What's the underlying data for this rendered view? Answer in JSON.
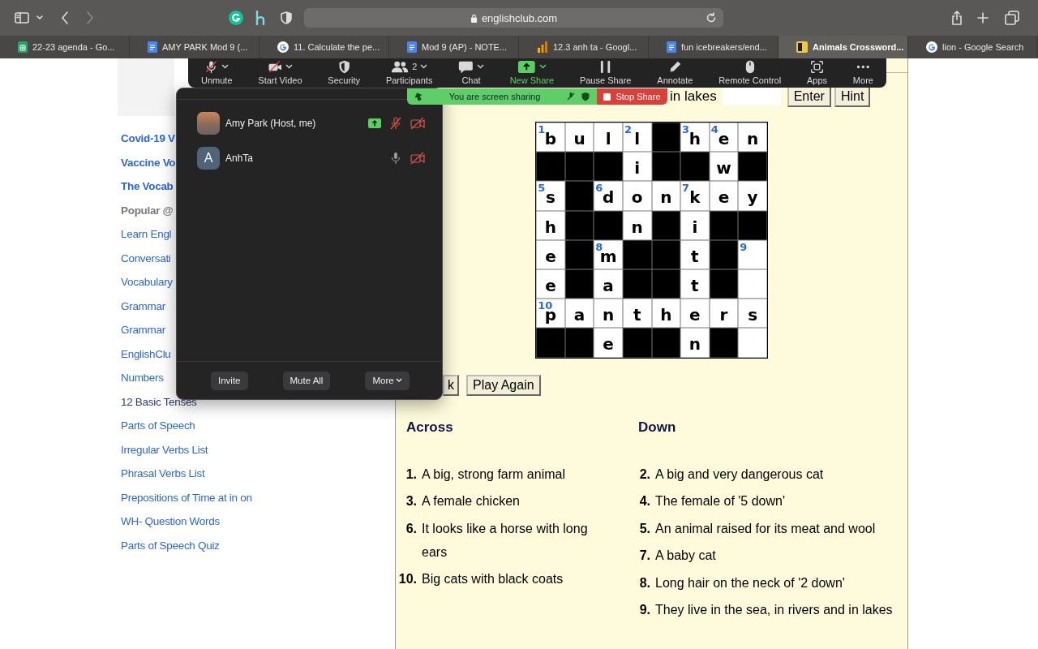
{
  "browser": {
    "address": "englishclub.com",
    "forward_disabled": true,
    "tabs": [
      {
        "title": "22-23 agenda - Go...",
        "kind": "sheets",
        "selected": false
      },
      {
        "title": "AMY PARK Mod 9 (...",
        "kind": "docs",
        "selected": false
      },
      {
        "title": "11. Calculate the pe...",
        "kind": "google",
        "selected": false
      },
      {
        "title": "Mod 9 (AP) - NOTE...",
        "kind": "docs",
        "selected": false
      },
      {
        "title": "12.3 anh ta - Googl...",
        "kind": "chart",
        "selected": false
      },
      {
        "title": "fun icebreakers/end...",
        "kind": "docs",
        "selected": false
      },
      {
        "title": "Animals Crossword...",
        "kind": "site",
        "selected": true
      },
      {
        "title": "lion - Google Search",
        "kind": "google",
        "selected": false
      }
    ]
  },
  "sidebar": {
    "links": [
      {
        "label": "Covid-19 V",
        "kind": "featured"
      },
      {
        "label": "Vaccine Vo",
        "kind": "featured"
      },
      {
        "label": "The Vocab",
        "kind": "featured"
      },
      {
        "label": "Popular @",
        "kind": "heading"
      },
      {
        "label": "Learn Engl",
        "kind": "link"
      },
      {
        "label": "Conversati",
        "kind": "link"
      },
      {
        "label": "Vocabulary",
        "kind": "link"
      },
      {
        "label": "Grammar",
        "kind": "link"
      },
      {
        "label": "Grammar",
        "kind": "link"
      },
      {
        "label": "EnglishClu",
        "kind": "link"
      },
      {
        "label": "Numbers",
        "kind": "link"
      },
      {
        "label": "12 Basic Tenses",
        "kind": "visited"
      },
      {
        "label": "Parts of Speech",
        "kind": "link"
      },
      {
        "label": "Irregular Verbs List",
        "kind": "link"
      },
      {
        "label": "Phrasal Verbs List",
        "kind": "link"
      },
      {
        "label": "Prepositions of Time at in on",
        "kind": "link"
      },
      {
        "label": "WH- Question Words",
        "kind": "link"
      },
      {
        "label": "Parts of Speech Quiz",
        "kind": "link"
      }
    ]
  },
  "crossword": {
    "clue_fragment": "in lakes",
    "top_buttons": [
      "Enter",
      "Hint"
    ],
    "grid": [
      [
        {
          "kind": "open",
          "number": "1",
          "letter": "b"
        },
        {
          "kind": "open",
          "letter": "u"
        },
        {
          "kind": "open",
          "letter": "l"
        },
        {
          "kind": "open",
          "number": "2",
          "letter": "l"
        },
        {
          "kind": "block"
        },
        {
          "kind": "open",
          "number": "3",
          "letter": "h"
        },
        {
          "kind": "open",
          "number": "4",
          "letter": "e"
        },
        {
          "kind": "open",
          "letter": "n"
        }
      ],
      [
        {
          "kind": "block"
        },
        {
          "kind": "block"
        },
        {
          "kind": "block"
        },
        {
          "kind": "open",
          "letter": "i"
        },
        {
          "kind": "block"
        },
        {
          "kind": "block"
        },
        {
          "kind": "open",
          "letter": "w"
        },
        {
          "kind": "block"
        }
      ],
      [
        {
          "kind": "open",
          "number": "5",
          "letter": "s"
        },
        {
          "kind": "block"
        },
        {
          "kind": "open",
          "number": "6",
          "letter": "d"
        },
        {
          "kind": "open",
          "letter": "o"
        },
        {
          "kind": "open",
          "letter": "n"
        },
        {
          "kind": "open",
          "number": "7",
          "letter": "k"
        },
        {
          "kind": "open",
          "letter": "e"
        },
        {
          "kind": "open",
          "letter": "y"
        }
      ],
      [
        {
          "kind": "open",
          "letter": "h"
        },
        {
          "kind": "block"
        },
        {
          "kind": "block"
        },
        {
          "kind": "open",
          "letter": "n"
        },
        {
          "kind": "block"
        },
        {
          "kind": "open",
          "letter": "i"
        },
        {
          "kind": "block"
        },
        {
          "kind": "block"
        }
      ],
      [
        {
          "kind": "open",
          "letter": "e"
        },
        {
          "kind": "block"
        },
        {
          "kind": "open",
          "number": "8",
          "letter": "m"
        },
        {
          "kind": "block"
        },
        {
          "kind": "block"
        },
        {
          "kind": "open",
          "letter": "t"
        },
        {
          "kind": "block"
        },
        {
          "kind": "open",
          "number": "9"
        }
      ],
      [
        {
          "kind": "open",
          "letter": "e"
        },
        {
          "kind": "block"
        },
        {
          "kind": "open",
          "letter": "a"
        },
        {
          "kind": "block"
        },
        {
          "kind": "block"
        },
        {
          "kind": "open",
          "letter": "t"
        },
        {
          "kind": "block"
        },
        {
          "kind": "open"
        }
      ],
      [
        {
          "kind": "open",
          "number": "10",
          "letter": "p"
        },
        {
          "kind": "open",
          "letter": "a"
        },
        {
          "kind": "open",
          "letter": "n"
        },
        {
          "kind": "open",
          "letter": "t"
        },
        {
          "kind": "open",
          "letter": "h"
        },
        {
          "kind": "open",
          "letter": "e"
        },
        {
          "kind": "open",
          "letter": "r"
        },
        {
          "kind": "open",
          "letter": "s"
        }
      ],
      [
        {
          "kind": "block"
        },
        {
          "kind": "block"
        },
        {
          "kind": "open",
          "letter": "e"
        },
        {
          "kind": "block"
        },
        {
          "kind": "block"
        },
        {
          "kind": "open",
          "letter": "n"
        },
        {
          "kind": "block"
        },
        {
          "kind": "open"
        }
      ]
    ],
    "bottom_buttons": [
      "k",
      "Play Again"
    ],
    "across": {
      "title": "Across",
      "clues": [
        {
          "number": "1.",
          "text": "A big, strong farm animal"
        },
        {
          "number": "3.",
          "text": "A female chicken"
        },
        {
          "number": "6.",
          "text": "It looks like a horse with long ears"
        },
        {
          "number": "10.",
          "text": "Big cats with black coats"
        }
      ]
    },
    "down": {
      "title": "Down",
      "clues": [
        {
          "number": "2.",
          "text": "A big and very dangerous cat"
        },
        {
          "number": "4.",
          "text": "The female of '5 down'"
        },
        {
          "number": "5.",
          "text": "An animal raised for its meat and wool"
        },
        {
          "number": "7.",
          "text": "A baby cat"
        },
        {
          "number": "8.",
          "text": "Long hair on the neck of '2 down'"
        },
        {
          "number": "9.",
          "text": "They live in the sea, in rivers and in lakes"
        }
      ]
    }
  },
  "meeting_toolbar": {
    "items": [
      {
        "label": "Unmute",
        "kind": "mic",
        "off": true,
        "caret": true,
        "active": false
      },
      {
        "label": "Start Video",
        "kind": "video",
        "off": true,
        "caret": true,
        "active": false
      },
      {
        "label": "Security",
        "kind": "security",
        "caret": false,
        "active": false
      },
      {
        "label": "Participants",
        "kind": "participants",
        "count": "2",
        "caret": true,
        "active": false
      },
      {
        "label": "Chat",
        "kind": "chat",
        "caret": true,
        "active": false
      },
      {
        "label": "New Share",
        "kind": "share",
        "caret": true,
        "active": true
      },
      {
        "label": "Pause Share",
        "kind": "pause",
        "caret": false,
        "active": false
      },
      {
        "label": "Annotate",
        "kind": "annotate",
        "caret": false,
        "active": false
      },
      {
        "label": "Remote Control",
        "kind": "remote",
        "caret": false,
        "active": false
      },
      {
        "label": "Apps",
        "kind": "apps",
        "caret": false,
        "active": false
      },
      {
        "label": "More",
        "kind": "more",
        "caret": false,
        "active": false
      }
    ]
  },
  "share_banner": {
    "status": "You are screen sharing",
    "stop_label": "Stop Share"
  },
  "participants_panel": {
    "participants": [
      {
        "name": "Amy Park (Host, me)",
        "kind": "photo",
        "sharing": true,
        "muted": true,
        "video_off": true
      },
      {
        "name": "AnhTa",
        "kind": "initial",
        "initial": "A",
        "sharing": false,
        "muted": false,
        "video_off": true
      }
    ],
    "buttons": [
      "Invite",
      "Mute All",
      "More"
    ]
  }
}
